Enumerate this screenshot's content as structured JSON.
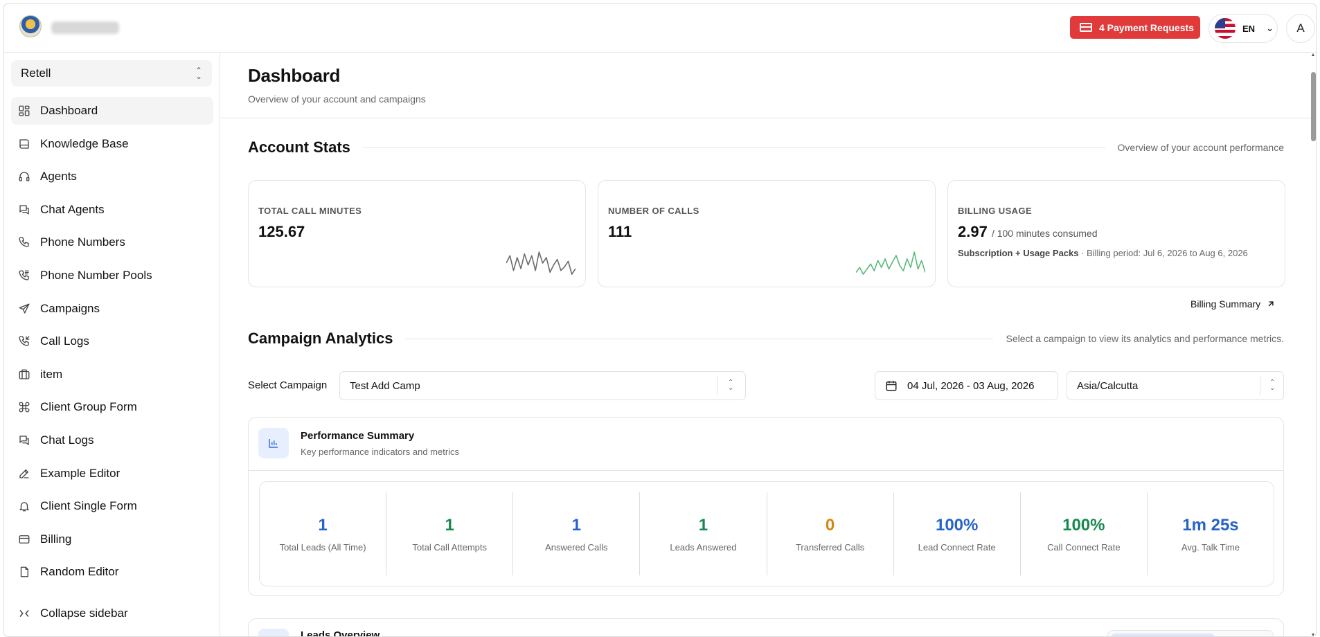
{
  "topbar": {
    "payment_requests": "4 Payment Requests",
    "language": "EN",
    "avatar_initial": "A"
  },
  "sidebar": {
    "org": "Retell",
    "items": [
      {
        "label": "Dashboard",
        "icon": "dashboard-icon",
        "active": true
      },
      {
        "label": "Knowledge Base",
        "icon": "book-icon"
      },
      {
        "label": "Agents",
        "icon": "headset-icon"
      },
      {
        "label": "Chat Agents",
        "icon": "chat-icon"
      },
      {
        "label": "Phone Numbers",
        "icon": "phone-icon"
      },
      {
        "label": "Phone Number Pools",
        "icon": "phone-pool-icon"
      },
      {
        "label": "Campaigns",
        "icon": "send-icon"
      },
      {
        "label": "Call Logs",
        "icon": "phone-log-icon"
      },
      {
        "label": "item",
        "icon": "box-icon"
      },
      {
        "label": "Client Group Form",
        "icon": "command-icon"
      },
      {
        "label": "Chat Logs",
        "icon": "chat-log-icon"
      },
      {
        "label": "Example Editor",
        "icon": "edit-icon"
      },
      {
        "label": "Client Single Form",
        "icon": "bell-icon"
      },
      {
        "label": "Billing",
        "icon": "credit-card-icon"
      },
      {
        "label": "Random Editor",
        "icon": "file-icon"
      }
    ],
    "collapse_label": "Collapse sidebar"
  },
  "page": {
    "title": "Dashboard",
    "subtitle": "Overview of your account and campaigns"
  },
  "account_stats": {
    "title": "Account Stats",
    "description": "Overview of your account performance",
    "cards": {
      "minutes": {
        "label": "TOTAL CALL MINUTES",
        "value": "125.67",
        "spark_color": "#6b6b6b",
        "spark": [
          10,
          14,
          6,
          13,
          7,
          15,
          9,
          14,
          6,
          16,
          10,
          13,
          5,
          9,
          12,
          6,
          8,
          11,
          4,
          7
        ]
      },
      "calls": {
        "label": "NUMBER OF CALLS",
        "value": "111",
        "spark_color": "#5cb87a",
        "spark": [
          4,
          7,
          3,
          6,
          9,
          5,
          11,
          7,
          12,
          6,
          10,
          14,
          8,
          5,
          12,
          7,
          16,
          6,
          11,
          4
        ]
      },
      "billing": {
        "label": "BILLING USAGE",
        "value": "2.97",
        "suffix": "/ 100 minutes consumed",
        "plan": "Subscription + Usage Packs",
        "period": "· Billing period: Jul 6, 2026 to Aug 6, 2026"
      }
    },
    "billing_summary_link": "Billing Summary"
  },
  "campaign_analytics": {
    "title": "Campaign Analytics",
    "description": "Select a campaign to view its analytics and performance metrics.",
    "select_label": "Select Campaign",
    "selected_campaign": "Test Add Camp",
    "date_range": "04 Jul, 2026 - 03 Aug, 2026",
    "timezone": "Asia/Calcutta"
  },
  "performance": {
    "title": "Performance Summary",
    "subtitle": "Key performance indicators and metrics",
    "metrics": [
      {
        "value": "1",
        "label": "Total Leads (All Time)",
        "color": "#2563c9"
      },
      {
        "value": "1",
        "label": "Total Call Attempts",
        "color": "#16894e"
      },
      {
        "value": "1",
        "label": "Answered Calls",
        "color": "#2563c9"
      },
      {
        "value": "1",
        "label": "Leads Answered",
        "color": "#16894e"
      },
      {
        "value": "0",
        "label": "Transferred Calls",
        "color": "#d4880f"
      },
      {
        "value": "100%",
        "label": "Lead Connect Rate",
        "color": "#2563c9"
      },
      {
        "value": "100%",
        "label": "Call Connect Rate",
        "color": "#16894e"
      },
      {
        "value": "1m 25s",
        "label": "Avg. Talk Time",
        "color": "#2563c9"
      }
    ]
  },
  "leads": {
    "title": "Leads Overview"
  }
}
